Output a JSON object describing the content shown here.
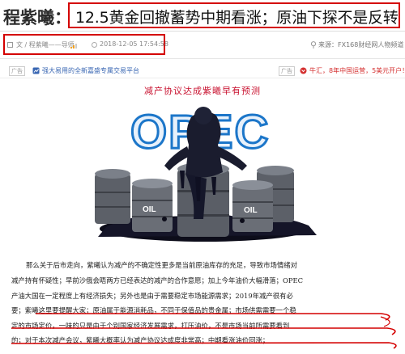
{
  "header": {
    "author_name": "程紫曦：",
    "headline": "12.5黄金回撤蓄势中期看涨；原油下探不是反转"
  },
  "meta": {
    "author": "文 / 程紫曦——导师",
    "date": "2018-12-05 17:54:58",
    "source": "来源：FX168财经网人物频道"
  },
  "ads": {
    "left_tag": "广告",
    "left_text": "强大易用的全新嘉盛专属交易平台",
    "right_tag": "广告",
    "right_text": "牛汇，8年中国运营，5美元开户！"
  },
  "image": {
    "caption": "减产协议达成紫曦早有预测",
    "logo_text": "OPEC",
    "barrel_label": "OIL"
  },
  "article": {
    "lines": [
      "那么关于后市走向，紫曦认为减产的不确定性更多是当前原油库存的充足，导致市场情绪对",
      "减产持有怀疑性；早前沙俄会晤两方已经表达的减产的合作意愿；加上今年油价大幅滑落；OPEC",
      "产油大国在一定程度上有经济损失；另外也是由于需要稳定市场能源需求；2019年减产很有必",
      "要；紫曦这里要提醒大家；原油属于能源消耗品，不同于保值品的贵金属；市场供需需要一个稳",
      "定的市场定价，一味的只是由于个别国家经济发展需求，打压油价，不是市场当前所需要看到",
      "的；对于本次减产会议，紫曦大概率认为减产协议达成度非常高；中期看涨油价回涨；",
      ""
    ]
  },
  "colors": {
    "highlight_border": "#d40000",
    "caption_red": "#c8102e",
    "ad_blue": "#3a67b3",
    "ad_red": "#d42f2f"
  }
}
